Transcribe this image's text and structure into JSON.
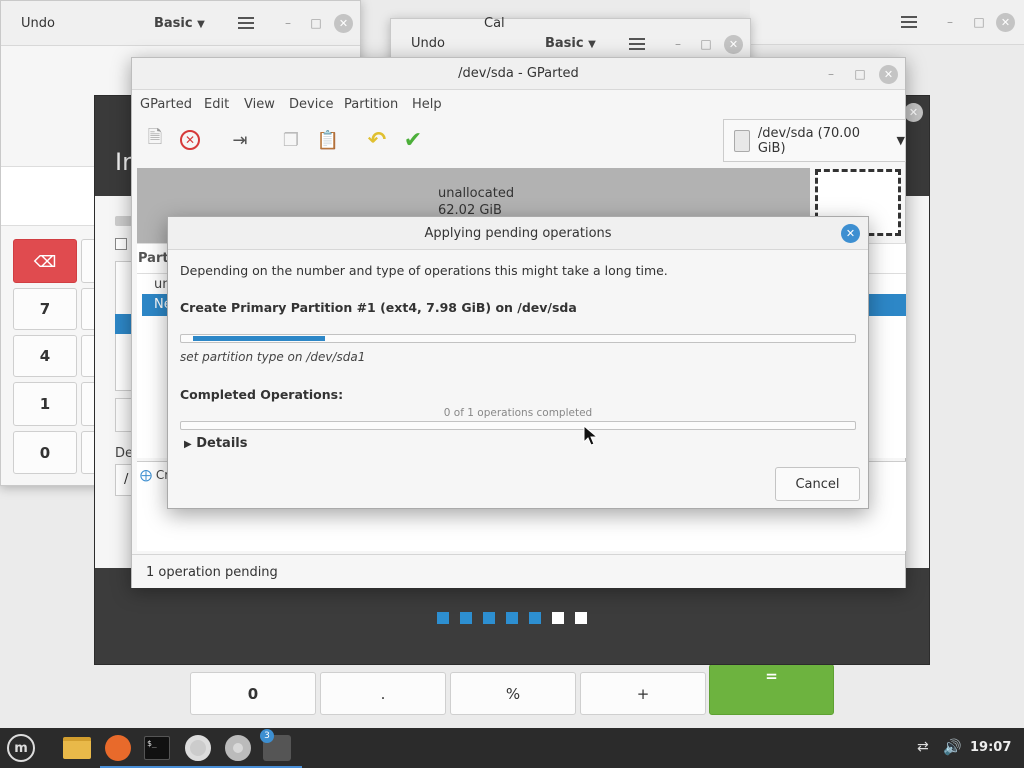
{
  "calculator_back": {
    "undo": "Undo",
    "mode": "Basic",
    "bottom_keys": [
      "0",
      ".",
      "%",
      "+",
      "="
    ],
    "left_keys": [
      "7",
      "4",
      "1",
      "0"
    ]
  },
  "calculator_mid": {
    "undo": "Undo",
    "mode": "Basic",
    "title_fragment": "Cal"
  },
  "installer": {
    "heading_fragment": "In",
    "label_fragment": "De",
    "field_fragment": "/",
    "dots": [
      "done",
      "done",
      "done",
      "done",
      "done",
      "todo",
      "todo"
    ]
  },
  "gparted": {
    "title": "/dev/sda - GParted",
    "menu": [
      "GParted",
      "Edit",
      "View",
      "Device",
      "Partition",
      "Help"
    ],
    "device": "/dev/sda (70.00 GiB)",
    "unallocated_label": "unallocated",
    "unallocated_size": "62.02 GiB",
    "list_header_fragment": "Parti",
    "row1_fragment": "un",
    "row2_fragment": "Ne",
    "pending_fragment": "Cr",
    "status": "1 operation pending",
    "colors": {
      "selection": "#2d87c7"
    }
  },
  "dialog": {
    "title": "Applying pending operations",
    "description": "Depending on the number and type of operations this might take a long time.",
    "operation": "Create Primary Partition #1 (ext4, 7.98 GiB) on /dev/sda",
    "current_progress": 0.2,
    "current_step": "set partition type on /dev/sda1",
    "completed_heading": "Completed Operations:",
    "completed_text": "0 of 1 operations completed",
    "completed_progress": 0,
    "details_label": "Details",
    "cancel_label": "Cancel"
  },
  "taskbar": {
    "badge": "3",
    "clock": "19:07"
  }
}
